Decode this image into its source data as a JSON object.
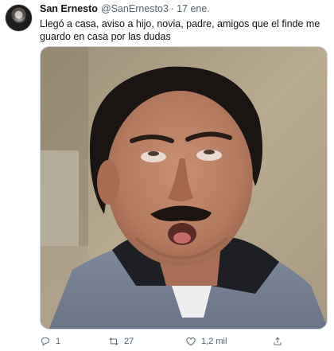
{
  "tweet": {
    "author_name": "San Ernesto",
    "author_handle": "@SanErnesto3",
    "separator": "·",
    "date": "17 ene.",
    "text": "Llegó a casa, aviso a hijo, novia, padre, amigos que el finde me guardo en casa por las dudas"
  },
  "actions": {
    "replies": "1",
    "retweets": "27",
    "likes": "1,2 mil"
  },
  "icons": [
    "avatar",
    "reply-icon",
    "retweet-icon",
    "like-icon",
    "share-icon"
  ],
  "colors": {
    "text": "#0f1419",
    "secondary": "#536471",
    "border": "#cfd9de"
  }
}
